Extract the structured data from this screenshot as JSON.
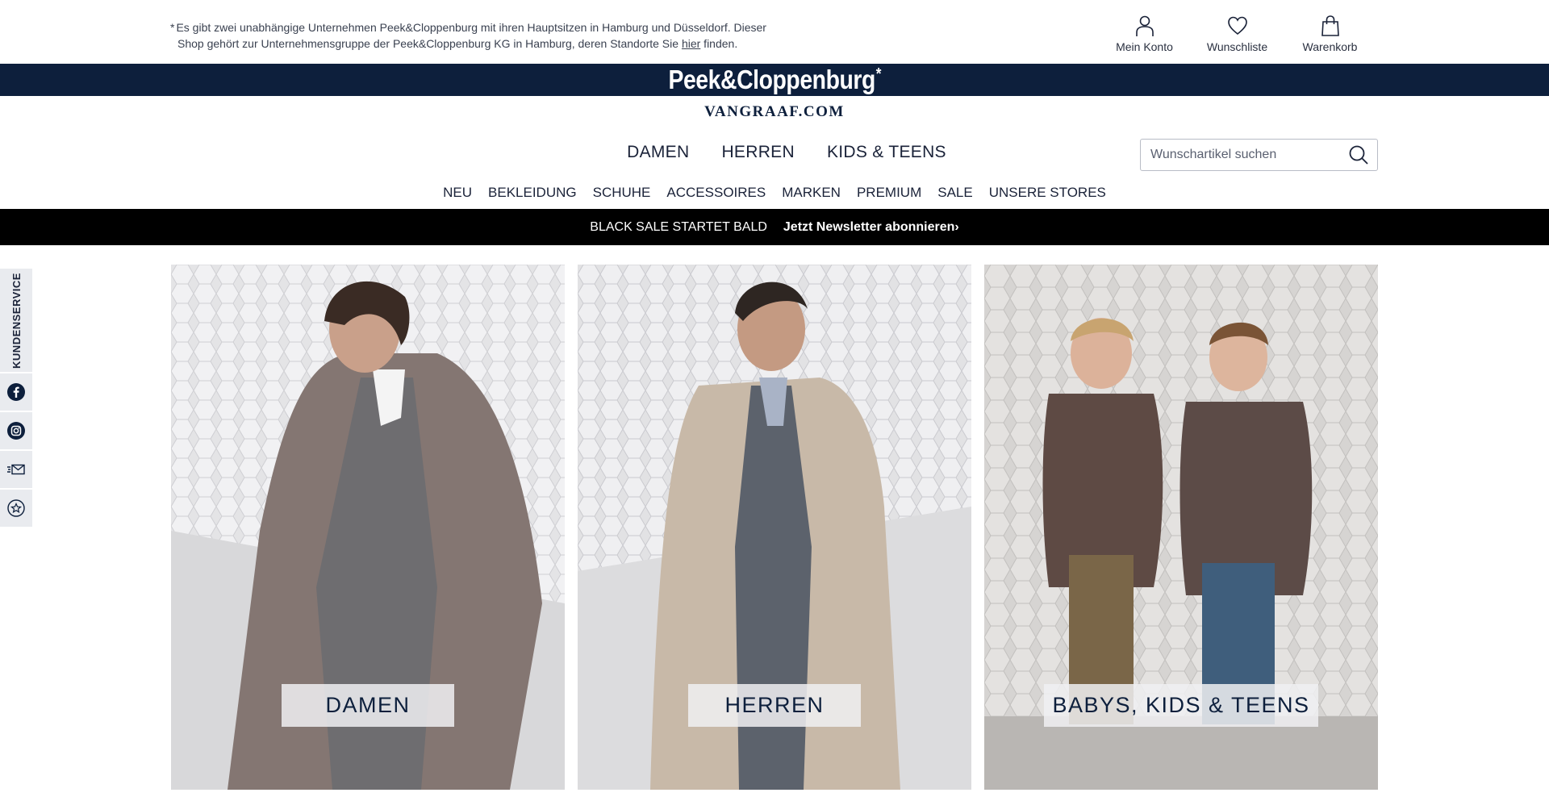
{
  "notice": {
    "star": "*",
    "line1": "Es gibt zwei unabhängige Unternehmen Peek&Cloppenburg mit ihren Hauptsitzen in Hamburg und Düsseldorf. Dieser",
    "line2_before": "Shop gehört zur Unternehmensgruppe der Peek&Cloppenburg KG in Hamburg, deren Standorte Sie ",
    "line2_link": "hier",
    "line2_after": " finden."
  },
  "top_actions": [
    {
      "label": "Mein Konto",
      "icon": "user-icon"
    },
    {
      "label": "Wunschliste",
      "icon": "heart-icon"
    },
    {
      "label": "Warenkorb",
      "icon": "bag-icon"
    }
  ],
  "brand": {
    "name": "Peek&Cloppenburg",
    "mark": "*",
    "sub": "VANGRAAF.COM"
  },
  "main_nav": [
    "DAMEN",
    "HERREN",
    "KIDS & TEENS"
  ],
  "search": {
    "placeholder": "Wunschartikel suchen"
  },
  "sub_nav": [
    "NEU",
    "BEKLEIDUNG",
    "SCHUHE",
    "ACCESSOIRES",
    "MARKEN",
    "PREMIUM",
    "SALE",
    "UNSERE STORES"
  ],
  "promo": {
    "text": "BLACK SALE STARTET BALD",
    "cta": "Jetzt Newsletter abonnieren",
    "cta_icon": "chevron-right-icon"
  },
  "rail": {
    "tab": "KUNDENSERVICE",
    "buttons": [
      "facebook-icon",
      "instagram-icon",
      "newsletter-icon",
      "star-badge-icon"
    ]
  },
  "tiles": [
    {
      "label": "DAMEN"
    },
    {
      "label": "HERREN"
    },
    {
      "label": "BABYS, KIDS & TEENS"
    }
  ]
}
